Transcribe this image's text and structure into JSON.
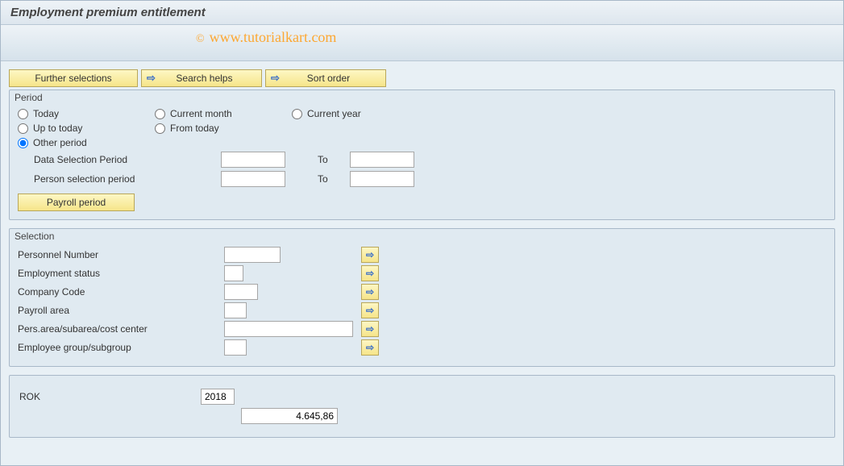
{
  "title": "Employment premium entitlement",
  "watermark": "www.tutorialkart.com",
  "toolbar": {
    "further_selections": "Further selections",
    "search_helps": "Search helps",
    "sort_order": "Sort order"
  },
  "period": {
    "group_title": "Period",
    "today": "Today",
    "current_month": "Current month",
    "current_year": "Current year",
    "up_to_today": "Up to today",
    "from_today": "From today",
    "other_period": "Other period",
    "data_selection_period": "Data Selection Period",
    "to": "To",
    "person_selection_period": "Person selection period",
    "payroll_period": "Payroll period",
    "data_from": "",
    "data_to": "",
    "person_from": "",
    "person_to": ""
  },
  "selection": {
    "group_title": "Selection",
    "personnel_number": "Personnel Number",
    "employment_status": "Employment status",
    "company_code": "Company Code",
    "payroll_area": "Payroll area",
    "pers_area": "Pers.area/subarea/cost center",
    "employee_group": "Employee group/subgroup",
    "val_personnel": "",
    "val_emp_status": "",
    "val_company": "",
    "val_payroll": "",
    "val_pers_area": "",
    "val_emp_group": ""
  },
  "rok": {
    "label": "ROK",
    "year": "2018",
    "amount": "4.645,86"
  }
}
